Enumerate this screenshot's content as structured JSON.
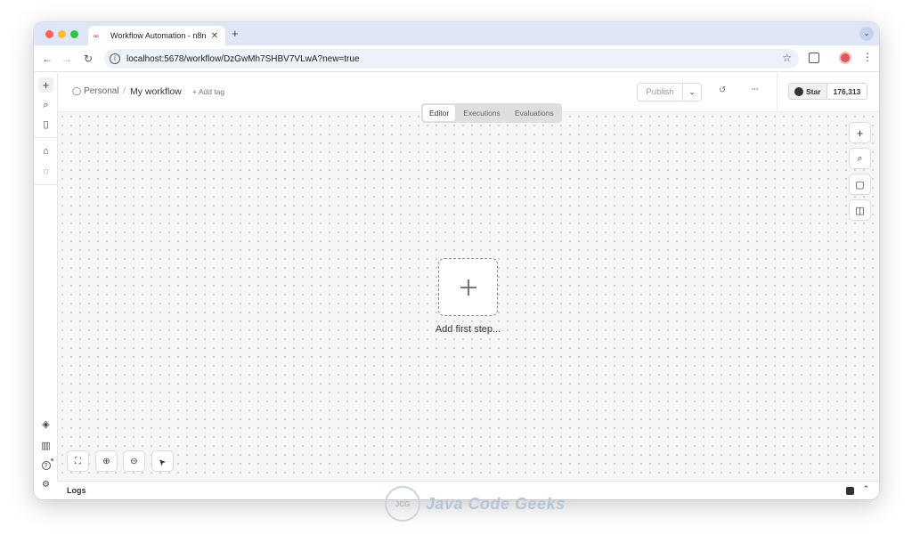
{
  "browser": {
    "tab_favicon": "n8n",
    "tab_title": "Workflow Automation - n8n",
    "tab_close": "✕",
    "new_tab": "+",
    "tab_menu": "⌄",
    "back": "←",
    "forward": "→",
    "reload": "↻",
    "info": "i",
    "url": "localhost:5678/workflow/DzGwMh7SHBV7VLwA?new=true",
    "bookmark": "☆",
    "menu": "⋮"
  },
  "sidebar": {
    "top_icons": [
      "plus-icon",
      "search-icon",
      "panel-icon"
    ],
    "mid_icons": [
      "home-icon",
      "chat-icon"
    ],
    "bottom_icons": [
      "templates-icon",
      "insights-icon",
      "help-icon",
      "settings-icon"
    ],
    "glyphs": {
      "plus": "+",
      "search": "⌕",
      "panel": "▯",
      "home": "⌂",
      "chat": "◌",
      "templates": "◈",
      "insights": "▥",
      "help": "?",
      "settings": "⚙"
    }
  },
  "header": {
    "project": "Personal",
    "separator": "/",
    "workflow_name": "My workflow",
    "add_tag": "+ Add tag",
    "publish_label": "Publish",
    "publish_dropdown": "⌄",
    "history": "↺",
    "more": "···"
  },
  "github": {
    "star_label": "Star",
    "star_count": "176,313"
  },
  "view_tabs": [
    {
      "label": "Editor",
      "active": true
    },
    {
      "label": "Executions",
      "active": false
    },
    {
      "label": "Evaluations",
      "active": false
    }
  ],
  "canvas_tools": {
    "add": "+",
    "search": "⌕",
    "sticky": "▢",
    "panel": "◫"
  },
  "canvas": {
    "add_first_step": "Add first step..."
  },
  "zoom_controls": {
    "fit": "⛶",
    "zoom_in": "⊕",
    "zoom_out": "⊖",
    "tidy": "➤"
  },
  "logs": {
    "label": "Logs",
    "chevron": "⌃"
  },
  "watermark": {
    "text": "Java Code Geeks"
  },
  "colors": {
    "accent": "#ea4b71",
    "canvas_bg": "#f6f6f6",
    "tab_strip": "#dfe7f6"
  }
}
